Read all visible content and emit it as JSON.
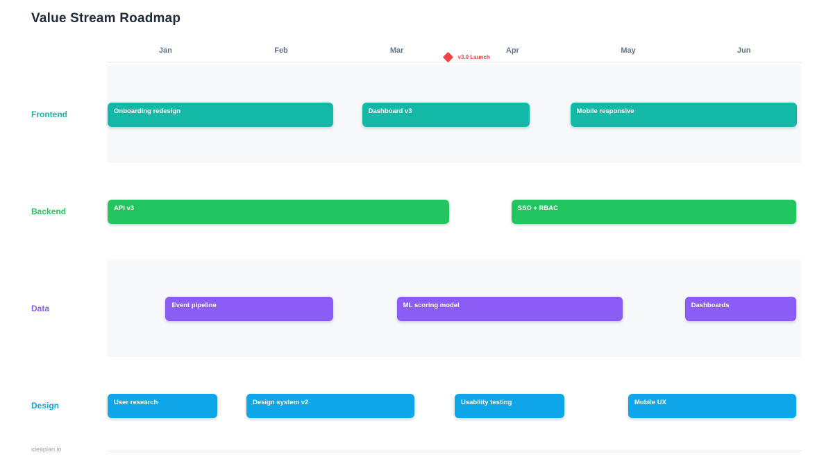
{
  "page": {
    "title": "Value Stream Roadmap",
    "footer": "ideaplan.io"
  },
  "chart_data": {
    "type": "bar",
    "variant": "gantt-roadmap",
    "title": "Value Stream Roadmap",
    "x_axis": {
      "labels": [
        "Jan",
        "Feb",
        "Mar",
        "Apr",
        "May",
        "Jun"
      ],
      "range_months": [
        0,
        6
      ],
      "grid": false
    },
    "milestone": {
      "label": "v3.0 Launch",
      "month": 2.94,
      "color": "#ef4444"
    },
    "lanes": [
      {
        "name": "Frontend",
        "color": "#14b8a6",
        "tasks": [
          {
            "label": "Onboarding redesign",
            "start": 0.0,
            "end": 1.95
          },
          {
            "label": "Dashboard v3",
            "start": 2.2,
            "end": 3.65
          },
          {
            "label": "Mobile responsive",
            "start": 4.0,
            "end": 5.96
          }
        ]
      },
      {
        "name": "Backend",
        "color": "#22c55e",
        "tasks": [
          {
            "label": "API v3",
            "start": 0.0,
            "end": 2.95
          },
          {
            "label": "SSO + RBAC",
            "start": 3.49,
            "end": 5.95
          }
        ]
      },
      {
        "name": "Data",
        "color": "#8b5cf6",
        "tasks": [
          {
            "label": "Event pipeline",
            "start": 0.5,
            "end": 1.95
          },
          {
            "label": "ML scoring model",
            "start": 2.5,
            "end": 4.45
          },
          {
            "label": "Dashboards",
            "start": 4.99,
            "end": 5.95
          }
        ]
      },
      {
        "name": "Design",
        "color": "#0ea5e9",
        "tasks": [
          {
            "label": "User research",
            "start": 0.0,
            "end": 0.95
          },
          {
            "label": "Design system v2",
            "start": 1.2,
            "end": 2.65
          },
          {
            "label": "Usability testing",
            "start": 3.0,
            "end": 3.95
          },
          {
            "label": "Mobile UX",
            "start": 4.5,
            "end": 5.95
          }
        ]
      }
    ],
    "colors": {
      "title_text": "#1f2937",
      "month_text": "#64748b",
      "stripe_bg": "#f7f8fa",
      "rule_line": "#e5e7eb",
      "footer_text": "#9ca3af",
      "milestone_red": "#ef4444"
    }
  }
}
